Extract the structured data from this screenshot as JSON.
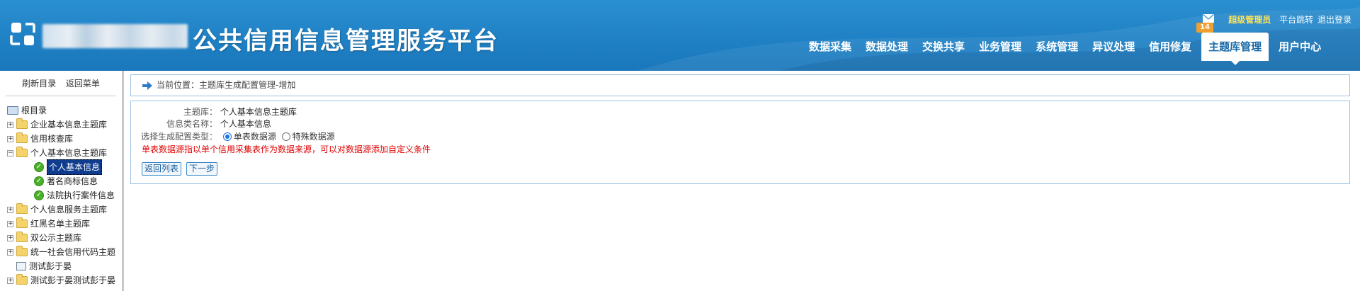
{
  "header": {
    "title": "公共信用信息管理服务平台",
    "user": {
      "name": "超级管理员",
      "switch_label": "平台跳转",
      "logout_label": "退出登录",
      "message_count": "14"
    },
    "nav": [
      {
        "label": "数据采集"
      },
      {
        "label": "数据处理"
      },
      {
        "label": "交换共享"
      },
      {
        "label": "业务管理"
      },
      {
        "label": "系统管理"
      },
      {
        "label": "异议处理"
      },
      {
        "label": "信用修复"
      },
      {
        "label": "主题库管理",
        "active": true
      },
      {
        "label": "用户中心"
      }
    ]
  },
  "sidebar": {
    "refresh_label": "刷新目录",
    "back_label": "返回菜单",
    "tree": {
      "root": "根目录",
      "items": [
        {
          "label": "企业基本信息主题库",
          "expanded": false
        },
        {
          "label": "信用核查库",
          "expanded": false
        },
        {
          "label": "个人基本信息主题库",
          "expanded": true
        },
        {
          "label": "个人基本信息",
          "selected": true
        },
        {
          "label": "著名商标信息"
        },
        {
          "label": "法院执行案件信息"
        },
        {
          "label": "个人信息服务主题库",
          "expanded": false
        },
        {
          "label": "红黑名单主题库",
          "expanded": false
        },
        {
          "label": "双公示主题库",
          "expanded": false
        },
        {
          "label": "统一社会信用代码主题",
          "expanded": false
        },
        {
          "label": "测试彭于晏"
        },
        {
          "label": "测试彭于晏测试彭于晏",
          "expanded": false
        }
      ]
    }
  },
  "main": {
    "breadcrumb": "当前位置：主题库生成配置管理-增加",
    "form": {
      "theme_label": "主题库：",
      "theme_value": "个人基本信息主题库",
      "info_label": "信息类名称：",
      "info_value": "个人基本信息",
      "type_label": "选择生成配置类型：",
      "options": [
        {
          "label": "单表数据源",
          "checked": true
        },
        {
          "label": "特殊数据源",
          "checked": false
        }
      ],
      "note": "单表数据源指以单个信用采集表作为数据来源，可以对数据源添加自定义条件",
      "back_button": "返回列表",
      "next_button": "下一步"
    }
  }
}
